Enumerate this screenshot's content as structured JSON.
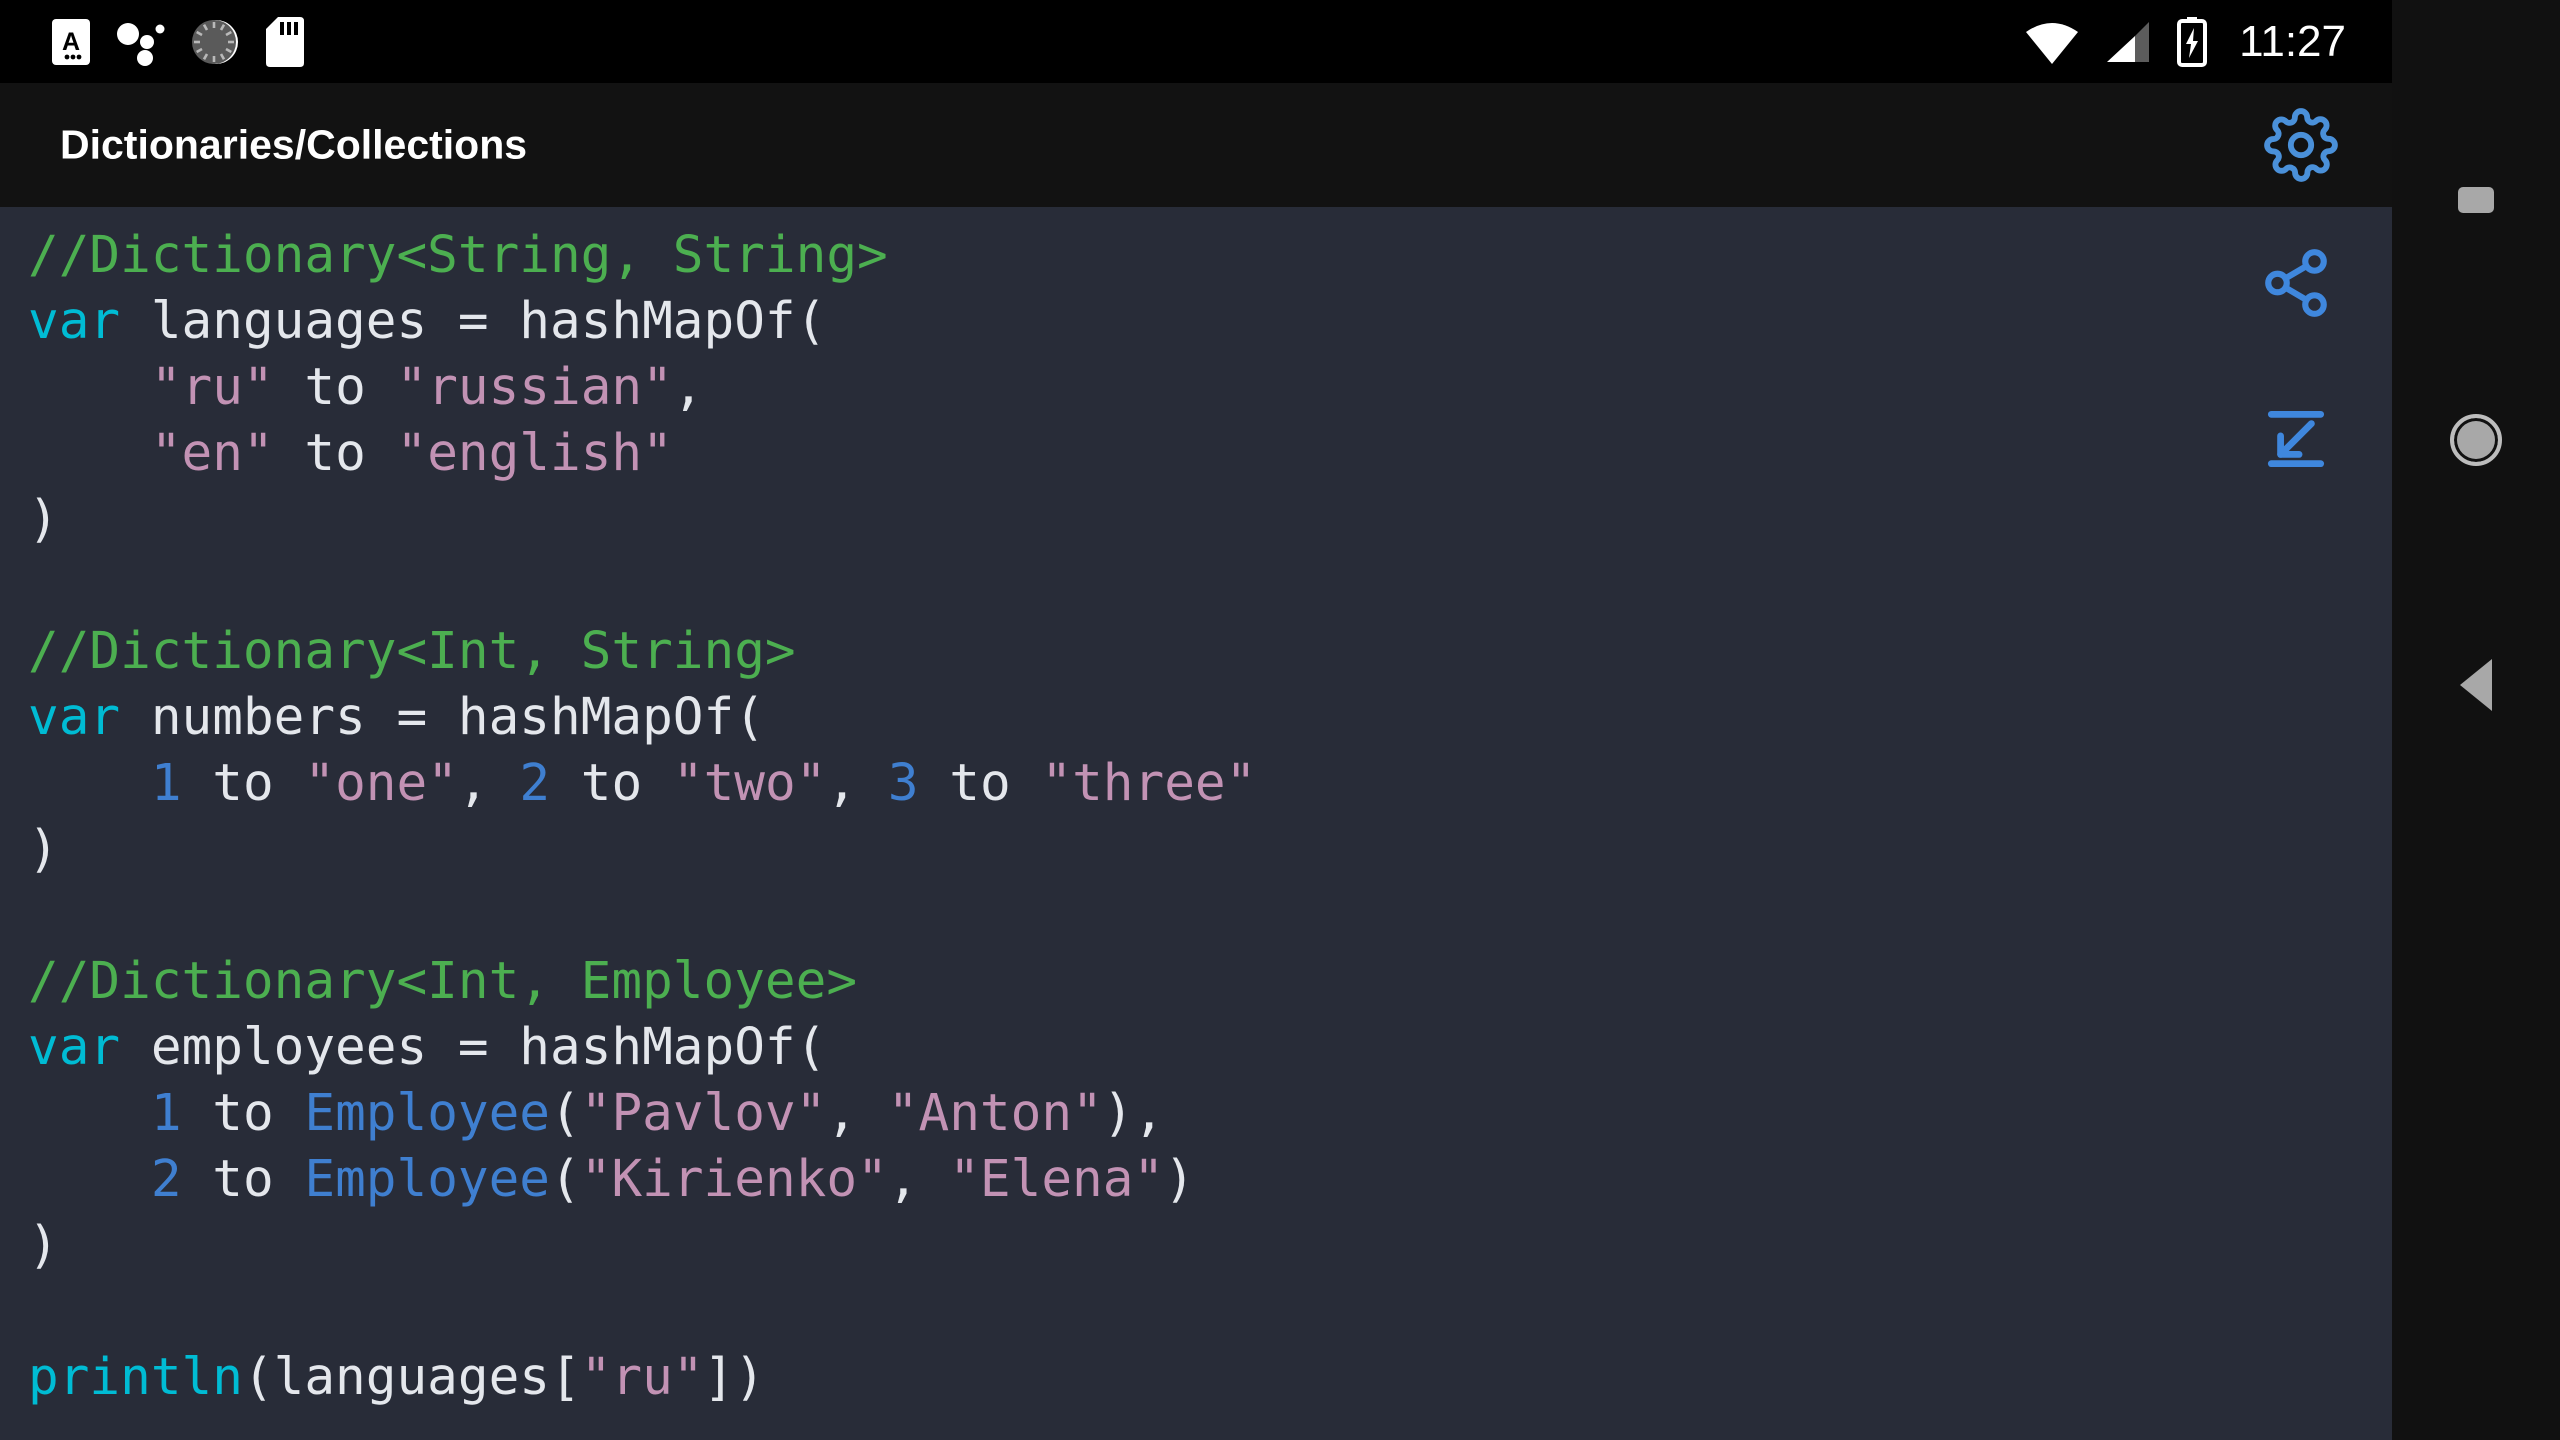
{
  "status_bar": {
    "background": "#000000",
    "left_icons": [
      {
        "name": "caps-lock-a-icon",
        "label": "A"
      },
      {
        "name": "bluetooth-cluster-icon",
        "label": "dots"
      },
      {
        "name": "loading-spinner-icon",
        "label": "sync"
      },
      {
        "name": "sd-card-icon",
        "label": "sd"
      }
    ],
    "right_icons": [
      {
        "name": "wifi-icon",
        "label": "wifi"
      },
      {
        "name": "cell-signal-icon",
        "label": "signal"
      },
      {
        "name": "battery-charging-icon",
        "label": "battery"
      }
    ],
    "clock": "11:27"
  },
  "app_bar": {
    "title": "Dictionaries/Collections",
    "background": "#121212",
    "settings_icon": "gear-icon",
    "accent": "#4a90d9"
  },
  "code_area": {
    "background": "#282c38",
    "share_icon": "share-icon",
    "fit_icon": "collapse-fit-icon",
    "accent": "#3f87dd",
    "theme_colors": {
      "comment": "#4caf50",
      "keyword": "#00bcd4",
      "string": "#c292b4",
      "number": "#3f7fd0",
      "class": "#3f7fd0",
      "plain": "#e4e7ec"
    },
    "lines": [
      [
        {
          "t": "//Dictionary<String, String>",
          "c": "comment"
        }
      ],
      [
        {
          "t": "var",
          "c": "keyword"
        },
        {
          "t": " languages = hashMapOf(",
          "c": "plain"
        }
      ],
      [
        {
          "t": "    ",
          "c": "plain"
        },
        {
          "t": "\"ru\"",
          "c": "string"
        },
        {
          "t": " to ",
          "c": "plain"
        },
        {
          "t": "\"russian\"",
          "c": "string"
        },
        {
          "t": ",",
          "c": "plain"
        }
      ],
      [
        {
          "t": "    ",
          "c": "plain"
        },
        {
          "t": "\"en\"",
          "c": "string"
        },
        {
          "t": " to ",
          "c": "plain"
        },
        {
          "t": "\"english\"",
          "c": "string"
        }
      ],
      [
        {
          "t": ")",
          "c": "plain"
        }
      ],
      [
        {
          "t": "",
          "c": "plain"
        }
      ],
      [
        {
          "t": "//Dictionary<Int, String>",
          "c": "comment"
        }
      ],
      [
        {
          "t": "var",
          "c": "keyword"
        },
        {
          "t": " numbers = hashMapOf(",
          "c": "plain"
        }
      ],
      [
        {
          "t": "    ",
          "c": "plain"
        },
        {
          "t": "1",
          "c": "number"
        },
        {
          "t": " to ",
          "c": "plain"
        },
        {
          "t": "\"one\"",
          "c": "string"
        },
        {
          "t": ", ",
          "c": "plain"
        },
        {
          "t": "2",
          "c": "number"
        },
        {
          "t": " to ",
          "c": "plain"
        },
        {
          "t": "\"two\"",
          "c": "string"
        },
        {
          "t": ", ",
          "c": "plain"
        },
        {
          "t": "3",
          "c": "number"
        },
        {
          "t": " to ",
          "c": "plain"
        },
        {
          "t": "\"three\"",
          "c": "string"
        }
      ],
      [
        {
          "t": ")",
          "c": "plain"
        }
      ],
      [
        {
          "t": "",
          "c": "plain"
        }
      ],
      [
        {
          "t": "//Dictionary<Int, Employee>",
          "c": "comment"
        }
      ],
      [
        {
          "t": "var",
          "c": "keyword"
        },
        {
          "t": " employees = hashMapOf(",
          "c": "plain"
        }
      ],
      [
        {
          "t": "    ",
          "c": "plain"
        },
        {
          "t": "1",
          "c": "number"
        },
        {
          "t": " to ",
          "c": "plain"
        },
        {
          "t": "Employee",
          "c": "class"
        },
        {
          "t": "(",
          "c": "plain"
        },
        {
          "t": "\"Pavlov\"",
          "c": "string"
        },
        {
          "t": ", ",
          "c": "plain"
        },
        {
          "t": "\"Anton\"",
          "c": "string"
        },
        {
          "t": "),",
          "c": "plain"
        }
      ],
      [
        {
          "t": "    ",
          "c": "plain"
        },
        {
          "t": "2",
          "c": "number"
        },
        {
          "t": " to ",
          "c": "plain"
        },
        {
          "t": "Employee",
          "c": "class"
        },
        {
          "t": "(",
          "c": "plain"
        },
        {
          "t": "\"Kirienko\"",
          "c": "string"
        },
        {
          "t": ", ",
          "c": "plain"
        },
        {
          "t": "\"Elena\"",
          "c": "string"
        },
        {
          "t": ")",
          "c": "plain"
        }
      ],
      [
        {
          "t": ")",
          "c": "plain"
        }
      ],
      [
        {
          "t": "",
          "c": "plain"
        }
      ],
      [
        {
          "t": "println",
          "c": "keyword"
        },
        {
          "t": "(languages[",
          "c": "plain"
        },
        {
          "t": "\"ru\"",
          "c": "string"
        },
        {
          "t": "])",
          "c": "plain"
        }
      ]
    ]
  },
  "nav_bar": {
    "background": "#111111",
    "buttons": [
      {
        "name": "recents-button",
        "icon": "square-icon"
      },
      {
        "name": "home-button",
        "icon": "circle-icon"
      },
      {
        "name": "back-button",
        "icon": "triangle-left-icon"
      }
    ]
  }
}
